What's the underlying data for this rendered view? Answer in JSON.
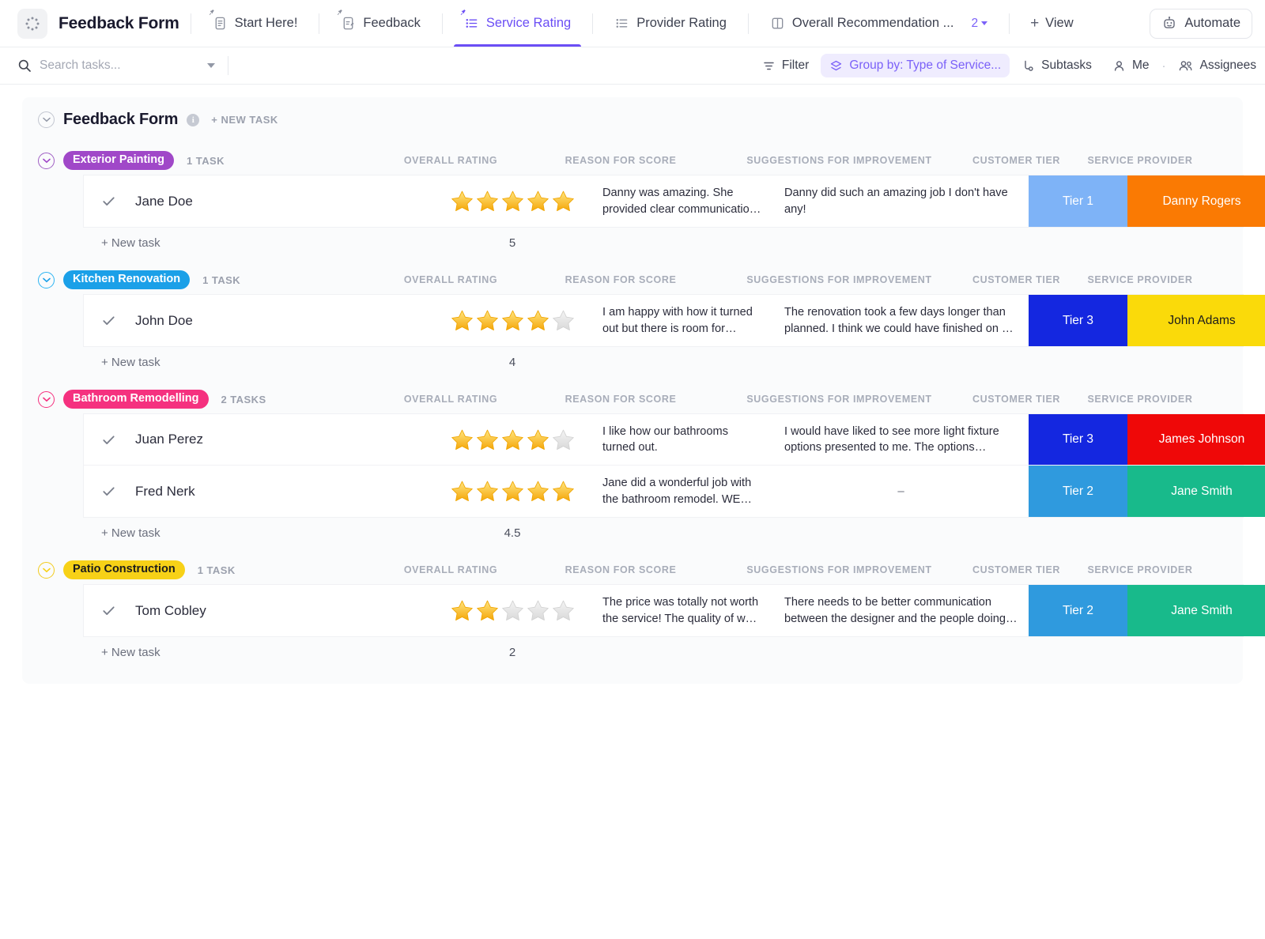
{
  "header": {
    "app_title": "Feedback Form",
    "tabs": [
      {
        "label": "Start Here!",
        "icon": "doc-icon",
        "active": false,
        "pinned": true
      },
      {
        "label": "Feedback",
        "icon": "doc-edit-icon",
        "active": false,
        "pinned": true
      },
      {
        "label": "Service Rating",
        "icon": "list-icon",
        "active": true,
        "pinned": true
      },
      {
        "label": "Provider Rating",
        "icon": "list-icon",
        "active": false,
        "pinned": false
      },
      {
        "label": "Overall Recommendation ...",
        "icon": "board-icon",
        "active": false,
        "pinned": false
      }
    ],
    "tab_count": "2",
    "view_label": "View",
    "automate_label": "Automate",
    "accent_color": "#6b4ef5"
  },
  "toolbar": {
    "search_placeholder": "Search tasks...",
    "search_value": "",
    "filter_label": "Filter",
    "group_by_label": "Group by: Type of Service...",
    "subtasks_label": "Subtasks",
    "me_label": "Me",
    "assignees_label": "Assignees"
  },
  "list": {
    "title": "Feedback Form",
    "new_task_label": "+ NEW TASK",
    "new_task_row_label": "+ New task"
  },
  "columns": {
    "name": "",
    "overall_rating": "OVERALL RATING",
    "reason": "REASON FOR SCORE",
    "suggestions": "SUGGESTIONS FOR IMPROVEMENT",
    "customer_tier": "CUSTOMER TIER",
    "service_provider": "SERVICE PROVIDER"
  },
  "groups": [
    {
      "name": "Exterior Painting",
      "tag_color": "#a048c8",
      "task_count_label": "1 TASK",
      "rating_summary": "5",
      "tasks": [
        {
          "name": "Jane Doe",
          "rating": 5,
          "reason": "Danny was amazing. She provided clear communication of time…",
          "suggestions": "Danny did such an amazing job I don't have any!",
          "customer_tier": "Tier 1",
          "tier_color": "#7eb3f7",
          "service_provider": "Danny Rogers",
          "provider_color": "#fa7a03",
          "provider_text_dark": false
        }
      ]
    },
    {
      "name": "Kitchen Renovation",
      "tag_color": "#1ba0e8",
      "task_count_label": "1 TASK",
      "rating_summary": "4",
      "tasks": [
        {
          "name": "John Doe",
          "rating": 4,
          "reason": "I am happy with how it turned out but there is room for improvement",
          "suggestions": "The renovation took a few days longer than planned. I think we could have finished on …",
          "customer_tier": "Tier 3",
          "tier_color": "#1427e0",
          "service_provider": "John Adams",
          "provider_color": "#fada0a",
          "provider_text_dark": true
        }
      ]
    },
    {
      "name": "Bathroom Remodelling",
      "tag_color": "#f5317f",
      "task_count_label": "2 TASKS",
      "rating_summary": "4.5",
      "tasks": [
        {
          "name": "Juan Perez",
          "rating": 4,
          "reason": "I like how our bathrooms turned out.",
          "suggestions": "I would have liked to see more light fixture options presented to me. The options provided…",
          "customer_tier": "Tier 3",
          "tier_color": "#1427e0",
          "service_provider": "James Johnson",
          "provider_color": "#ef0808",
          "provider_text_dark": false
        },
        {
          "name": "Fred Nerk",
          "rating": 5,
          "reason": "Jane did a wonderful job with the bathroom remodel. WE LOVE IT!",
          "suggestions": "–",
          "customer_tier": "Tier 2",
          "tier_color": "#2f9ade",
          "service_provider": "Jane Smith",
          "provider_color": "#18ba8b",
          "provider_text_dark": false
        }
      ]
    },
    {
      "name": "Patio Construction",
      "tag_color": "#f7d117",
      "tag_text_dark": true,
      "task_count_label": "1 TASK",
      "rating_summary": "2",
      "tasks": [
        {
          "name": "Tom Cobley",
          "rating": 2,
          "reason": "The price was totally not worth the service! The quality of work …",
          "suggestions": "There needs to be better communication between the designer and the people doing the…",
          "customer_tier": "Tier 2",
          "tier_color": "#2f9ade",
          "service_provider": "Jane Smith",
          "provider_color": "#18ba8b",
          "provider_text_dark": false
        }
      ]
    }
  ]
}
